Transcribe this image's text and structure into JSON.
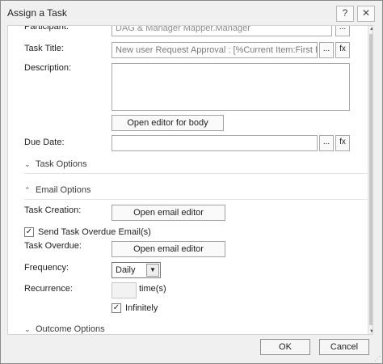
{
  "window": {
    "title": "Assign a Task",
    "help_label": "?",
    "close_label": "✕"
  },
  "fields": {
    "participant_label": "Participant:",
    "participant_value": "DAG & Manager Mapper.Manager",
    "task_title_label": "Task Title:",
    "task_title_value": "New user Request Approval : [%Current Item:First Name",
    "description_label": "Description:",
    "description_value": "",
    "open_editor_body": "Open editor for body",
    "due_date_label": "Due Date:",
    "due_date_value": "",
    "ellipsis": "...",
    "fx": "fx"
  },
  "sections": {
    "task_options": "Task Options",
    "email_options": "Email Options",
    "outcome_options": "Outcome Options",
    "collapsed_icon": "chevron-down-icon",
    "expanded_icon": "chevron-up-icon"
  },
  "email": {
    "task_creation_label": "Task Creation:",
    "open_email_editor": "Open email editor",
    "send_overdue_label": "Send Task Overdue Email(s)",
    "send_overdue_checked": true,
    "task_overdue_label": "Task Overdue:",
    "frequency_label": "Frequency:",
    "frequency_value": "Daily",
    "recurrence_label": "Recurrence:",
    "recurrence_value": "",
    "recurrence_unit": "time(s)",
    "infinitely_label": "Infinitely",
    "infinitely_checked": true
  },
  "footer": {
    "ok_label": "OK",
    "cancel_label": "Cancel"
  }
}
